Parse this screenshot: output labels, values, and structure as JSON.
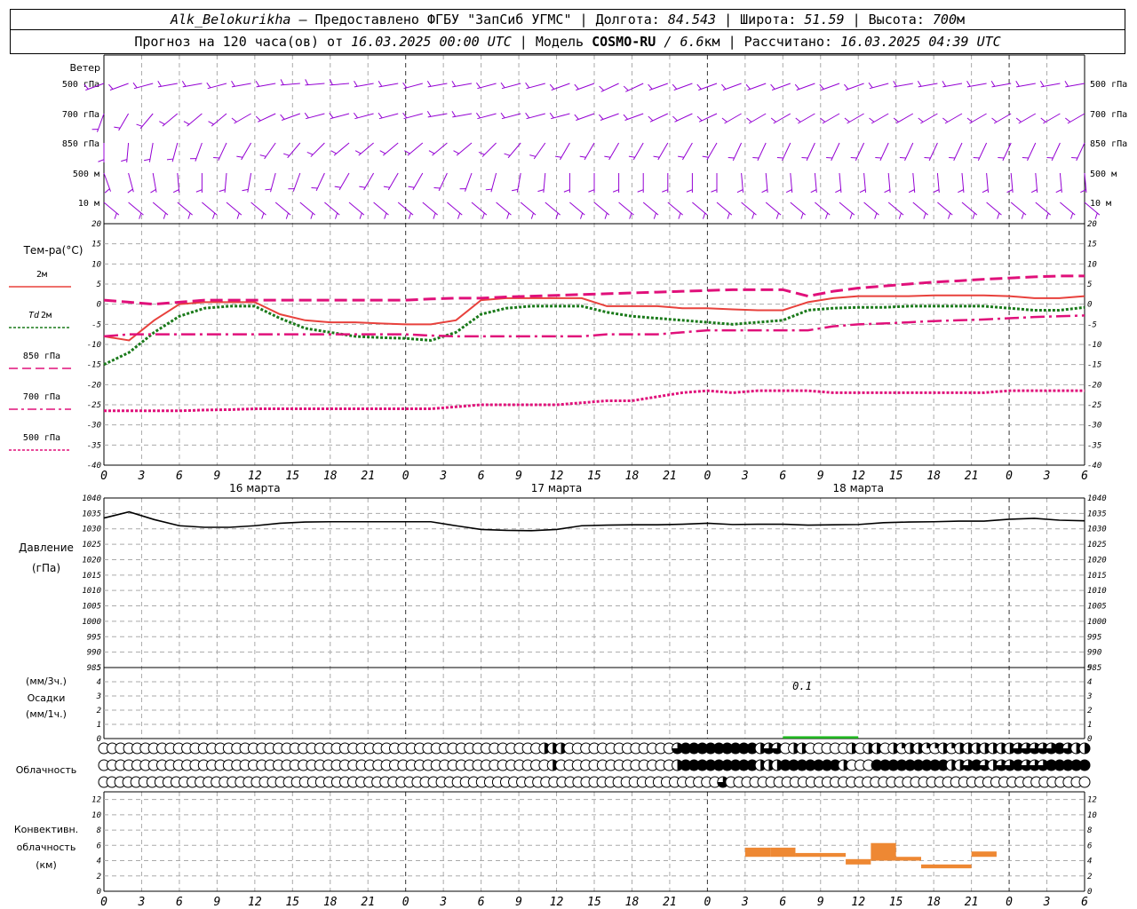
{
  "header": {
    "station": "Alk_Belokurikha",
    "provider": " – Предоставлено ФГБУ \"ЗапСиб УГМС\" | ",
    "lon_label": "Долгота: ",
    "lon_value": "84.543",
    "lat_label": " | Широта: ",
    "lat_value": "51.59",
    "alt_label": " | Высота: ",
    "alt_value": "700",
    "alt_unit": "м",
    "forecast_prefix": "Прогноз на 120 часа(ов) от ",
    "forecast_start": "16.03.2025 00:00 UTC",
    "model_label": "  | Модель ",
    "model_name": "COSMO-RU",
    "model_sep": " / ",
    "model_res": "6.6",
    "model_res_unit": "км",
    "calc_label": " | Рассчитано: ",
    "calc_time": "16.03.2025 04:39 UTC"
  },
  "wind_panel": {
    "title": "Ветер",
    "levels": [
      "500 гПа",
      "700 гПа",
      "850 гПа",
      "500 м",
      "10 м"
    ],
    "color": "#9400d3"
  },
  "temp_panel": {
    "title": "Тем-ра(°С)",
    "legend": [
      {
        "label": "2м",
        "color": "#e8413c",
        "style": "solid"
      },
      {
        "label_italic": "Td",
        "label": " 2м",
        "color": "#1a7a1a",
        "style": "dotted"
      },
      {
        "label": "850 гПа",
        "color": "#e0107a",
        "style": "dash"
      },
      {
        "label": "700 гПа",
        "color": "#e0107a",
        "style": "dashdot"
      },
      {
        "label": "500 гПа",
        "color": "#e0107a",
        "style": "dotted"
      }
    ]
  },
  "pressure_panel": {
    "title_1": "Давление",
    "title_2": "(гПа)"
  },
  "precip_panel": {
    "title_1": "(мм/3ч.)",
    "title_2": "Осадки",
    "title_3": "(мм/1ч.)",
    "annotation": "0.1"
  },
  "cloud_panel": {
    "title": "Облачность"
  },
  "conv_panel": {
    "title_1": "Конвективн.",
    "title_2": "облачность",
    "title_3": "(км)"
  },
  "time_axis": {
    "hour_labels": [
      "0",
      "3",
      "6",
      "9",
      "12",
      "15",
      "18",
      "21",
      "0",
      "3",
      "6",
      "9",
      "12",
      "15",
      "18",
      "21",
      "0",
      "3",
      "6",
      "9",
      "12",
      "15",
      "18",
      "21",
      "0",
      "3",
      "6"
    ],
    "date_labels": [
      "16 марта",
      "17 марта",
      "18 марта"
    ]
  },
  "chart_data": [
    {
      "type": "line",
      "name": "temperature",
      "x_hours": [
        0,
        2,
        4,
        6,
        8,
        10,
        12,
        14,
        16,
        18,
        20,
        22,
        24,
        26,
        28,
        30,
        32,
        34,
        36,
        38,
        40,
        42,
        44,
        46,
        48,
        50,
        52,
        54,
        56,
        58,
        60,
        62,
        64,
        66,
        68,
        70,
        72,
        74,
        76,
        78
      ],
      "ylim": [
        -40,
        20
      ],
      "yticks": [
        -40,
        -35,
        -30,
        -25,
        -20,
        -15,
        -10,
        -5,
        0,
        5,
        10,
        15,
        20
      ],
      "series": [
        {
          "name": "2м",
          "values": [
            -8,
            -9,
            -4,
            0,
            0.5,
            0.5,
            0.5,
            -2.5,
            -4,
            -4.5,
            -4.5,
            -4.8,
            -5,
            -5,
            -4,
            1,
            1.5,
            1.5,
            1.5,
            1.5,
            -0.5,
            -0.5,
            -0.5,
            -1,
            -1,
            -1.3,
            -1.5,
            -1.5,
            0.5,
            1.5,
            2,
            2,
            2,
            2.2,
            2.2,
            2.2,
            2,
            1.5,
            1.5,
            2
          ]
        },
        {
          "name": "Td 2м",
          "values": [
            -15,
            -12,
            -7,
            -3,
            -1,
            -0.5,
            -0.5,
            -3.5,
            -6,
            -7,
            -8,
            -8.3,
            -8.5,
            -9,
            -7,
            -2.5,
            -1,
            -0.5,
            -0.5,
            -0.5,
            -2,
            -3,
            -3.5,
            -4,
            -4.5,
            -5,
            -4.5,
            -4,
            -1.5,
            -1,
            -0.8,
            -0.8,
            -0.5,
            -0.5,
            -0.5,
            -0.5,
            -1,
            -1.5,
            -1.5,
            -0.8
          ]
        },
        {
          "name": "850 гПа",
          "values": [
            1,
            0.5,
            0,
            0.5,
            1,
            1,
            1,
            1,
            1,
            1,
            1,
            1,
            1,
            1.3,
            1.5,
            1.5,
            1.8,
            2,
            2.2,
            2.4,
            2.6,
            2.8,
            3,
            3.2,
            3.4,
            3.6,
            3.6,
            3.6,
            2,
            3.2,
            4,
            4.5,
            5,
            5.5,
            5.8,
            6.2,
            6.5,
            6.8,
            7,
            7
          ]
        },
        {
          "name": "700 гПа",
          "values": [
            -8,
            -7.5,
            -7.5,
            -7.5,
            -7.5,
            -7.5,
            -7.5,
            -7.5,
            -7.5,
            -7.5,
            -7.5,
            -7.5,
            -7.5,
            -7.8,
            -8,
            -8,
            -8,
            -8,
            -8,
            -8,
            -7.5,
            -7.5,
            -7.5,
            -7,
            -6.5,
            -6.5,
            -6.5,
            -6.5,
            -6.5,
            -5.5,
            -5,
            -4.8,
            -4.5,
            -4.2,
            -4,
            -3.8,
            -3.5,
            -3.2,
            -3,
            -2.8
          ]
        },
        {
          "name": "500 гПа",
          "values": [
            -26.5,
            -26.5,
            -26.5,
            -26.5,
            -26.3,
            -26.2,
            -26,
            -26,
            -26,
            -26,
            -26,
            -26,
            -26,
            -26,
            -25.5,
            -25,
            -25,
            -25,
            -25,
            -24.5,
            -24,
            -24,
            -23,
            -22,
            -21.5,
            -22,
            -21.5,
            -21.5,
            -21.5,
            -22,
            -22,
            -22,
            -22,
            -22,
            -22,
            -22,
            -21.5,
            -21.5,
            -21.5,
            -21.5
          ]
        }
      ]
    },
    {
      "type": "line",
      "name": "pressure",
      "x_hours": [
        0,
        2,
        4,
        6,
        8,
        10,
        12,
        14,
        16,
        18,
        20,
        22,
        24,
        26,
        28,
        30,
        32,
        34,
        36,
        38,
        40,
        42,
        44,
        46,
        48,
        50,
        52,
        54,
        56,
        58,
        60,
        62,
        64,
        66,
        68,
        70,
        72,
        74,
        76,
        78
      ],
      "ylim": [
        985,
        1040
      ],
      "yticks": [
        985,
        990,
        995,
        1000,
        1005,
        1010,
        1015,
        1020,
        1025,
        1030,
        1035,
        1040
      ],
      "values": [
        1033.5,
        1035.5,
        1033,
        1031,
        1030.5,
        1030.5,
        1031,
        1031.8,
        1032.2,
        1032.3,
        1032.3,
        1032.3,
        1032.3,
        1032.3,
        1031,
        1029.8,
        1029.5,
        1029.4,
        1029.8,
        1031,
        1031.2,
        1031.3,
        1031.3,
        1031.5,
        1031.8,
        1031.4,
        1031.5,
        1031.5,
        1031.2,
        1031.3,
        1031.4,
        1032,
        1032.2,
        1032.3,
        1032.5,
        1032.5,
        1033.1,
        1033.4,
        1032.8,
        1032.6
      ]
    },
    {
      "type": "bar",
      "name": "precipitation",
      "ylim": [
        0,
        5
      ],
      "yticks": [
        0,
        1,
        2,
        3,
        4,
        5
      ],
      "bars": [
        {
          "x_start": 54,
          "x_end": 60,
          "value": 0.1
        }
      ]
    },
    {
      "type": "bar",
      "name": "convective_cloud",
      "ylim": [
        0,
        13
      ],
      "yticks": [
        0,
        2,
        4,
        6,
        8,
        10,
        12
      ],
      "bars": [
        {
          "x_start": 51,
          "x_end": 53,
          "bottom": 4.5,
          "top": 5.7
        },
        {
          "x_start": 53,
          "x_end": 55,
          "bottom": 4.5,
          "top": 5.7
        },
        {
          "x_start": 55,
          "x_end": 59,
          "bottom": 4.5,
          "top": 5.0
        },
        {
          "x_start": 59,
          "x_end": 61,
          "bottom": 3.5,
          "top": 4.2
        },
        {
          "x_start": 61,
          "x_end": 63,
          "bottom": 4.0,
          "top": 6.3
        },
        {
          "x_start": 63,
          "x_end": 65,
          "bottom": 4.0,
          "top": 4.5
        },
        {
          "x_start": 65,
          "x_end": 69,
          "bottom": 3.0,
          "top": 3.5
        },
        {
          "x_start": 69,
          "x_end": 71,
          "bottom": 4.5,
          "top": 5.2
        }
      ]
    },
    {
      "type": "table",
      "name": "cloud_cover",
      "rows_comment": "three rows of cloud cover symbols, one per hour, 0 = clear, 1 = overcast",
      "row1": [
        0,
        0,
        0,
        0,
        0,
        0,
        0,
        0,
        0,
        0,
        0,
        0,
        0,
        0,
        0,
        0,
        0,
        0,
        0,
        0,
        0,
        0,
        0,
        0,
        0,
        0,
        0,
        0,
        0,
        0,
        0,
        0,
        0,
        0,
        0,
        0,
        0,
        0,
        0,
        0,
        0,
        0,
        0,
        0,
        0,
        0,
        0,
        0,
        0,
        0,
        0,
        0,
        0,
        0.5,
        0.5,
        0.5,
        0,
        0,
        0,
        0,
        0,
        0,
        0,
        0,
        0,
        0,
        0,
        0,
        0,
        0.75,
        1,
        1,
        1,
        1,
        1,
        1,
        1,
        1,
        1,
        0.5,
        0.75,
        0.75,
        0,
        0.5,
        0.5,
        0,
        0,
        0,
        0,
        0,
        0.5,
        0,
        0.5,
        0.5,
        0,
        0.5,
        0.25,
        0.5,
        0.5,
        0.25,
        0.25,
        0.5,
        0.25,
        0.5,
        0.5,
        0.5,
        0.5,
        0.5,
        0.5,
        0.5,
        0.75,
        0.75,
        0.75,
        0.75,
        0.75,
        1,
        0.75,
        0.5,
        0.5
      ],
      "row2": [
        0,
        0,
        0,
        0,
        0,
        0,
        0,
        0,
        0,
        0,
        0,
        0,
        0,
        0,
        0,
        0,
        0,
        0,
        0,
        0,
        0,
        0,
        0,
        0,
        0,
        0,
        0,
        0,
        0,
        0,
        0,
        0,
        0,
        0,
        0,
        0,
        0,
        0,
        0,
        0,
        0,
        0,
        0,
        0,
        0,
        0,
        0,
        0,
        0,
        0,
        0,
        0,
        0,
        0,
        0.5,
        0,
        0,
        0,
        0,
        0,
        0,
        0,
        0,
        0,
        0,
        0,
        0,
        0,
        0,
        0.5,
        1,
        1,
        1,
        1,
        1,
        1,
        1,
        1,
        1,
        0.5,
        0.5,
        0.5,
        1,
        1,
        1,
        1,
        1,
        1,
        1,
        0.5,
        0,
        0,
        0,
        1,
        1,
        1,
        1,
        1,
        1,
        1,
        1,
        1,
        0.5,
        0.5,
        0.75,
        1,
        0.75,
        0.5,
        0.75,
        0.75,
        1,
        0.75,
        0.75,
        0.75,
        1,
        1,
        1,
        1,
        1
      ],
      "row3": [
        0,
        0,
        0,
        0,
        0,
        0,
        0,
        0,
        0,
        0,
        0,
        0,
        0,
        0,
        0,
        0,
        0,
        0,
        0,
        0,
        0,
        0,
        0,
        0,
        0,
        0,
        0,
        0,
        0,
        0,
        0,
        0,
        0,
        0,
        0,
        0,
        0,
        0,
        0,
        0,
        0,
        0,
        0,
        0,
        0,
        0,
        0,
        0,
        0,
        0,
        0,
        0,
        0,
        0,
        0,
        0,
        0,
        0,
        0,
        0,
        0,
        0,
        0,
        0,
        0,
        0,
        0,
        0,
        0,
        0,
        0,
        0,
        0,
        0,
        0,
        0,
        0,
        0.75,
        0,
        0,
        0,
        0,
        0,
        0,
        0,
        0,
        0,
        0,
        0,
        0,
        0,
        0,
        0,
        0,
        0,
        0,
        0,
        0,
        0,
        0,
        0,
        0,
        0,
        0,
        0,
        0,
        0,
        0,
        0,
        0,
        0,
        0,
        0,
        0,
        0,
        0,
        0,
        0,
        0,
        0,
        0,
        0,
        0
      ]
    },
    {
      "type": "table",
      "name": "wind_barbs",
      "rows_comment": "wind direction (degrees, meteorological) per level sampled every 3 hours",
      "500 гПа": [
        250,
        250,
        255,
        260,
        260,
        255,
        260,
        260,
        265,
        265,
        265,
        260,
        260,
        255,
        260,
        260,
        255,
        255,
        255,
        250,
        250,
        245,
        245,
        250,
        250,
        250,
        250,
        250,
        250,
        250,
        250,
        250,
        255,
        260,
        260,
        260,
        260,
        260,
        260,
        260,
        260
      ],
      "700 гПа": [
        200,
        210,
        220,
        230,
        230,
        230,
        240,
        245,
        250,
        255,
        255,
        255,
        255,
        255,
        260,
        260,
        255,
        255,
        255,
        255,
        250,
        250,
        250,
        245,
        245,
        245,
        240,
        240,
        240,
        240,
        240,
        240,
        240,
        240,
        240,
        240,
        240,
        240,
        240,
        240,
        240
      ],
      "850 гПа": [
        180,
        185,
        190,
        195,
        200,
        205,
        210,
        215,
        220,
        225,
        230,
        230,
        230,
        230,
        230,
        230,
        225,
        220,
        215,
        210,
        210,
        210,
        210,
        210,
        210,
        210,
        205,
        205,
        205,
        205,
        205,
        205,
        205,
        205,
        205,
        205,
        205,
        205,
        205,
        205,
        205
      ],
      "500 м": [
        160,
        165,
        170,
        175,
        180,
        185,
        190,
        195,
        200,
        205,
        210,
        210,
        210,
        210,
        205,
        200,
        195,
        190,
        185,
        180,
        180,
        180,
        180,
        180,
        180,
        180,
        175,
        175,
        175,
        175,
        175,
        175,
        175,
        175,
        175,
        175,
        175,
        175,
        175,
        175,
        175
      ],
      "10 м": [
        130,
        130,
        130,
        130,
        130,
        130,
        130,
        130,
        130,
        130,
        130,
        130,
        130,
        130,
        130,
        130,
        130,
        130,
        130,
        130,
        130,
        130,
        130,
        130,
        130,
        130,
        130,
        130,
        130,
        130,
        130,
        130,
        130,
        130,
        130,
        130,
        130,
        130,
        130,
        130,
        130
      ]
    }
  ]
}
